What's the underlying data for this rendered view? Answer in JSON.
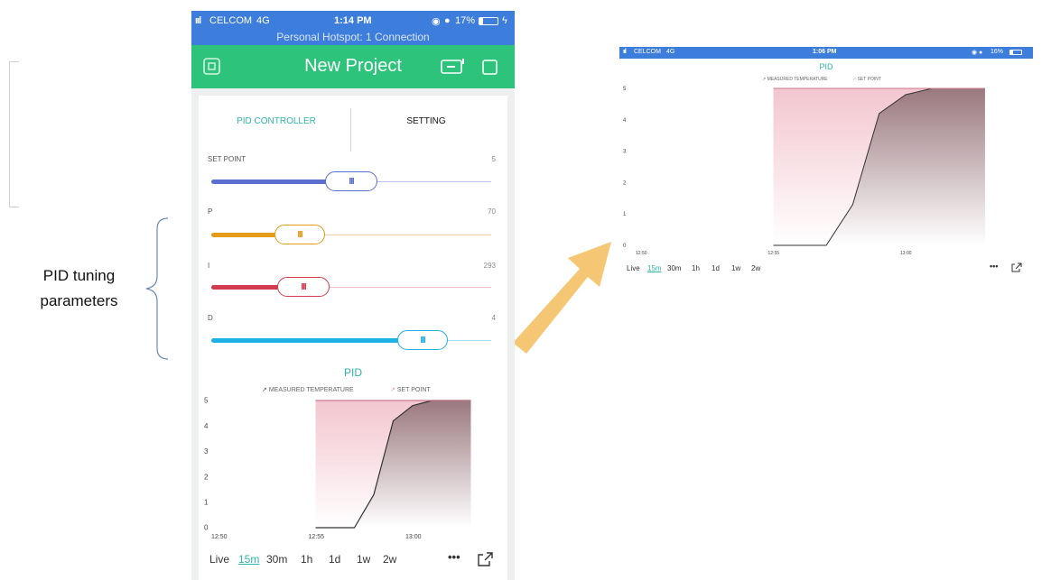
{
  "annotation": {
    "line1": "PID tuning",
    "line2": "parameters"
  },
  "phone": {
    "status": {
      "carrier": "CELCOM",
      "network": "4G",
      "time": "1:14 PM",
      "battery": "17%",
      "hotspot": "Personal Hotspot: 1 Connection"
    },
    "header": {
      "title": "New Project"
    },
    "tabs": [
      {
        "label": "PID CONTROLLER"
      },
      {
        "label": "SETTING"
      }
    ],
    "params": [
      {
        "label": "SET POINT",
        "value": "5"
      },
      {
        "label": "P",
        "value": "70"
      },
      {
        "label": "I",
        "value": "293"
      },
      {
        "label": "D",
        "value": "4"
      }
    ],
    "chart": {
      "title": "PID",
      "legend": [
        "MEASURED TEMPERATURE",
        "SET POINT"
      ],
      "y_ticks": [
        "5",
        "4",
        "3",
        "2",
        "1",
        "0"
      ],
      "x_ticks": [
        "12:50",
        "12:55",
        "13:00"
      ],
      "ranges": [
        "Live",
        "15m",
        "30m",
        "1h",
        "1d",
        "1w",
        "2w"
      ],
      "active_range": "15m"
    }
  },
  "right": {
    "status": {
      "carrier": "CELCOM",
      "network": "4G",
      "time": "1:06 PM",
      "battery": "16%"
    },
    "chart": {
      "title": "PID",
      "legend": [
        "MEASURED TEMPERATURE",
        "SET POINT"
      ],
      "y_ticks": [
        "5",
        "4",
        "3",
        "2",
        "1",
        "0"
      ],
      "x_ticks": [
        "12:50",
        "12:55",
        "13:00"
      ],
      "ranges": [
        "Live",
        "15m",
        "30m",
        "1h",
        "1d",
        "1w",
        "2w"
      ]
    }
  },
  "chart_data": {
    "type": "area",
    "title": "PID",
    "x_unit": "time",
    "ylim": [
      0,
      5
    ],
    "series": [
      {
        "name": "MEASURED TEMPERATURE",
        "x": [
          "12:55",
          "12:57",
          "12:58",
          "12:59",
          "13:00",
          "13:01"
        ],
        "values": [
          0,
          0,
          1.3,
          4.2,
          4.8,
          5
        ]
      },
      {
        "name": "SET POINT",
        "x": [
          "12:55",
          "13:03"
        ],
        "values": [
          5,
          5
        ]
      }
    ]
  },
  "colors": {
    "status_bar": "#3d7ddb",
    "header": "#2dc37b",
    "accent": "#2fb5a8",
    "setpoint": "#5b6fd0",
    "p": "#e59a18",
    "i": "#d23a4e",
    "d": "#1fb0e5",
    "arrow": "#f4c064"
  }
}
